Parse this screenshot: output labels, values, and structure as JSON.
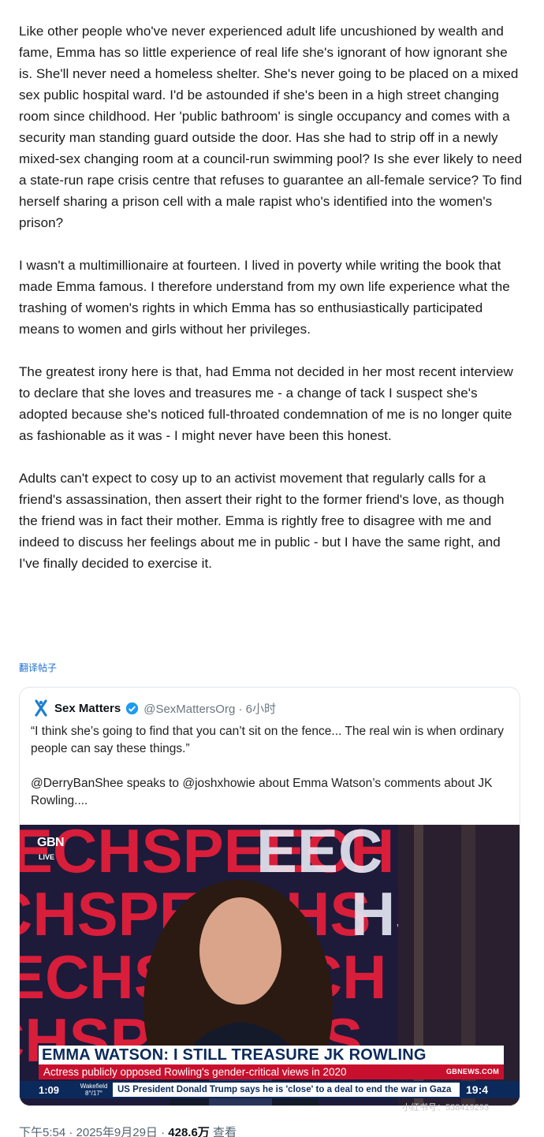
{
  "post": {
    "paragraphs": [
      "Like other people who've never experienced adult life uncushioned by wealth and fame, Emma has so little experience of real life she's ignorant of how ignorant she is. She'll never need a homeless shelter. She's never going to be placed on a mixed sex public hospital ward. I'd be astounded if she's been in a high street changing room since childhood. Her 'public bathroom' is single occupancy and comes with a security man standing guard outside the door. Has she had to strip off in a newly mixed-sex changing room at a council-run swimming pool? Is she ever likely to need a state-run rape crisis centre that refuses to guarantee an all-female service? To find herself sharing a prison cell with a male rapist who's identified into the women's prison?",
      "I wasn't a multimillionaire at fourteen. I lived in poverty while writing the book that made Emma famous. I therefore understand from my own life experience what the trashing of women's rights in which Emma has so enthusiastically participated means to women and girls without her privileges.",
      "The greatest irony here is that, had Emma not decided in her most recent interview to declare that she loves and treasures me - a change of tack I suspect she's adopted because she's noticed full-throated condemnation of me is no longer quite as fashionable as it was - I might never have been this honest.",
      "Adults can't expect to cosy up to an activist movement that regularly calls for a friend's assassination, then assert their right to the former friend's love, as though the friend was in fact their mother. Emma is rightly free to disagree with me and indeed to discuss her feelings about me in public - but I have the same right, and I've finally decided to exercise it."
    ],
    "translate_label": "翻译帖子"
  },
  "quote": {
    "name": "Sex Matters",
    "handle": "@SexMattersOrg · 6小时",
    "text1": "“I think she’s going to find that you can’t sit on the fence... The real win is when ordinary people can say these things.”",
    "text2": "@DerryBanShee speaks to @joshxhowie about Emma Watson’s comments about JK Rowling....",
    "video": {
      "channel_logo": "GBN",
      "live_label": "LIVE",
      "headline": "EMMA WATSON: I STILL TREASURE JK ROWLING",
      "subline": "Actress publicly opposed Rowling's gender-critical views in 2020",
      "site": "GBNEWS.COM",
      "duration": "1:09",
      "weather_loc": "Wakefield 8°/17°",
      "ticker": "US President Donald Trump says he is 'close' to a deal to end the war in Gaza",
      "clock": "19:4"
    }
  },
  "meta": {
    "time": "下午5:54 · 2025年9月29日 · ",
    "views": "428.6万",
    "views_label": " 查看"
  },
  "watermark": "小红书号：538419293"
}
